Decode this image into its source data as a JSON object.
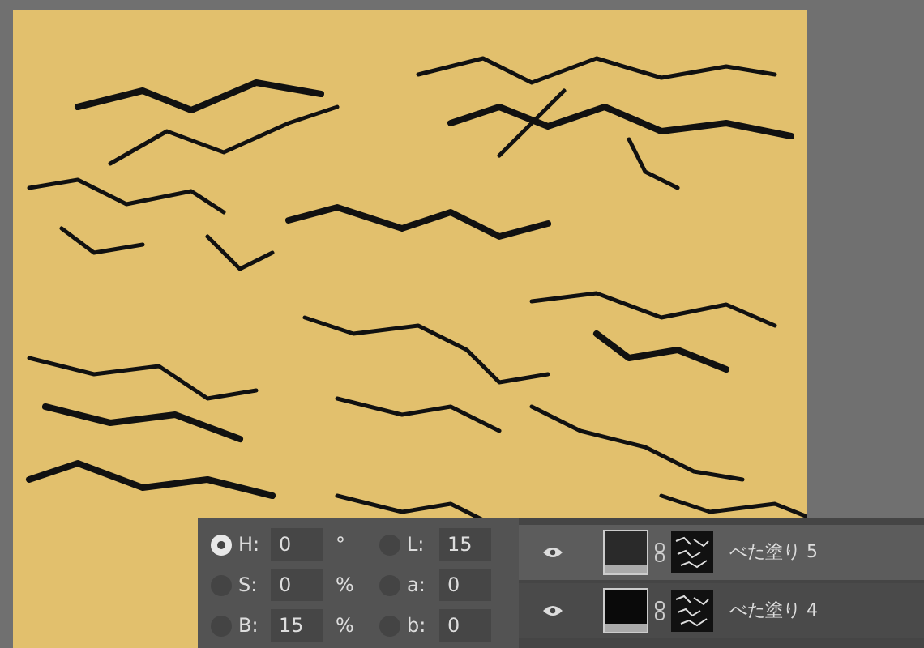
{
  "color_fields": {
    "hsb": [
      {
        "label": "H:",
        "value": "0",
        "unit": "°",
        "selected": true
      },
      {
        "label": "S:",
        "value": "0",
        "unit": "%",
        "selected": false
      },
      {
        "label": "B:",
        "value": "15",
        "unit": "%",
        "selected": false
      }
    ],
    "lab": [
      {
        "label": "L:",
        "value": "15",
        "selected": false
      },
      {
        "label": "a:",
        "value": "0",
        "selected": false
      },
      {
        "label": "b:",
        "value": "0",
        "selected": false
      }
    ]
  },
  "layers": [
    {
      "name": "べた塗り 5",
      "visible": true,
      "selected": true,
      "color": "#2a2a2a"
    },
    {
      "name": "べた塗り 4",
      "visible": true,
      "selected": false,
      "color": "#0a0a0a"
    }
  ]
}
